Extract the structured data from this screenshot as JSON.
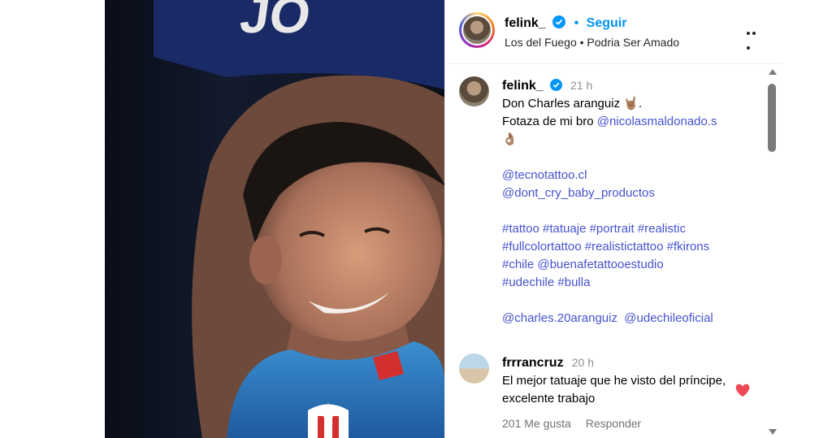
{
  "post": {
    "username": "felink_",
    "follow_label": "Seguir",
    "music": "Los del Fuego • Podria Ser Amado"
  },
  "caption": {
    "username": "felink_",
    "time": "21 h",
    "line1": "Don Charles aranguiz 🤘🏽.",
    "line2": "Fotaza de mi bro ",
    "mention_photographer": "@nicolasmaldonado.s",
    "line2_emoji": "👌🏽",
    "mentions1": [
      "@tecnotattoo.cl",
      "@dont_cry_baby_productos"
    ],
    "hashtags": [
      "#tattoo #tatuaje #portrait #realistic",
      "#fullcolortattoo #realistictattoo #fkirons",
      "#chile @buenafetattooestudio",
      "#udechile #bulla"
    ],
    "mentions2": "@charles.20aranguiz  @udechileoficial"
  },
  "comment": {
    "username": "frrrancruz",
    "time": "20 h",
    "text": "El mejor tatuaje que he visto del príncipe, excelente trabajo",
    "likes": "201 Me gusta",
    "reply_label": "Responder"
  },
  "colors": {
    "link": "#4553cf",
    "follow": "#0095f6",
    "heart": "#ed4956",
    "verified": "#0095f6"
  },
  "icons": {
    "verified": "verified-badge-icon",
    "more": "more-options-icon",
    "like": "heart-icon"
  }
}
